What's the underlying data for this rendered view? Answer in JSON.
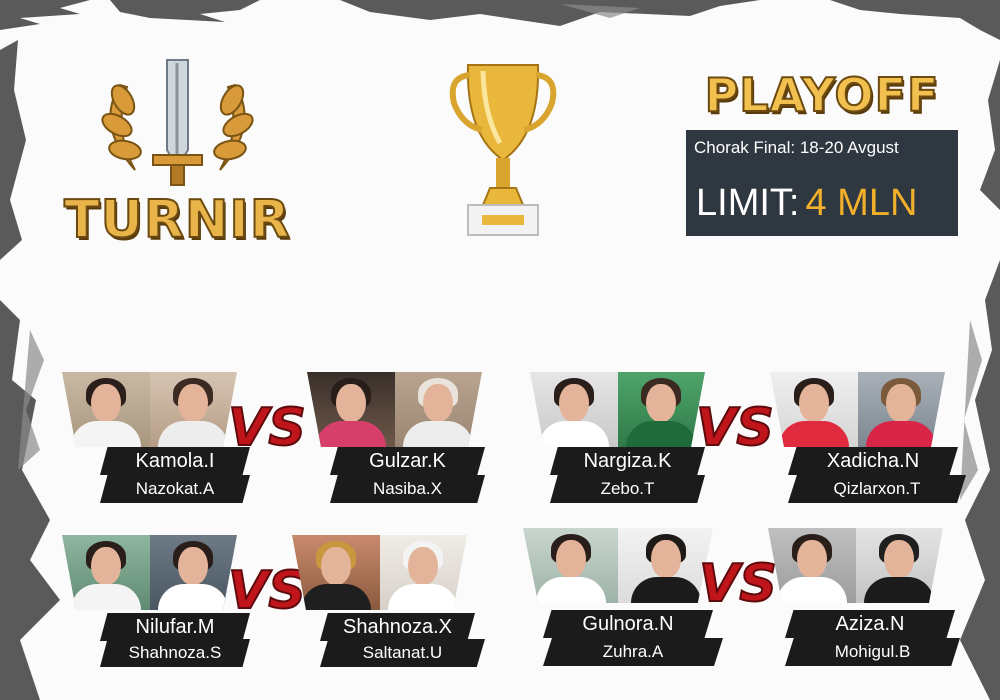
{
  "logo": {
    "text": "TURNIR"
  },
  "playoff": {
    "title": "PLAYOFF",
    "date": "Chorak Final: 18-20 Avgust",
    "limit_label": "LIMIT:",
    "limit_value": "4 MLN"
  },
  "vs_label": "VS",
  "matches": [
    {
      "left": {
        "name": "Kamola.I",
        "partner": "Nazokat.A"
      },
      "right": {
        "name": "Gulzar.K",
        "partner": "Nasiba.X"
      }
    },
    {
      "left": {
        "name": "Nargiza.K",
        "partner": "Zebo.T"
      },
      "right": {
        "name": "Xadicha.N",
        "partner": "Qizlarxon.T"
      }
    },
    {
      "left": {
        "name": "Nilufar.M",
        "partner": "Shahnoza.S"
      },
      "right": {
        "name": "Shahnoza.X",
        "partner": "Saltanat.U"
      }
    },
    {
      "left": {
        "name": "Gulnora.N",
        "partner": "Zuhra.A"
      },
      "right": {
        "name": "Aziza.N",
        "partner": "Mohigul.B"
      }
    }
  ],
  "colors": {
    "gold": "#e9b54a",
    "panel": "#2f3740",
    "accent": "#f2b02a",
    "vs_red": "#c0151b",
    "plate": "#1b1b1b"
  }
}
